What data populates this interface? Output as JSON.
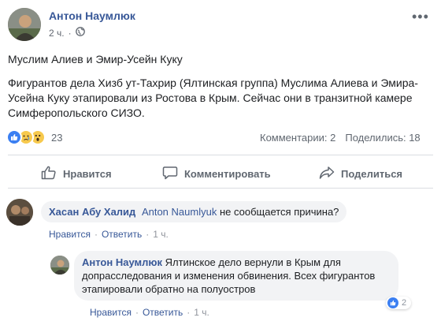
{
  "post": {
    "author": "Антон Наумлюк",
    "time": "2 ч.",
    "more_label": "•••",
    "title": "Муслим Алиев и Эмир-Усейн Куку",
    "body": "Фигурантов дела Хизб ут-Тахрир (Ялтинская группа) Муслима Алиева и Эмира-Усейна Куку этапировали из Ростова в Крым. Сейчас они в транзитной камере Симферопольского СИЗО.",
    "reaction_count": "23",
    "comments_stat": "Комментарии: 2",
    "shares_stat": "Поделились: 18",
    "reaction_icons": [
      "like-icon",
      "sad-icon",
      "wow-icon"
    ],
    "privacy_icon": "globe-icon"
  },
  "actions": {
    "like": "Нравится",
    "comment": "Комментировать",
    "share": "Поделиться"
  },
  "comments": [
    {
      "author": "Хасан Абу Халид",
      "mention": "Anton Naumlyuk",
      "text": " не сообщается причина?",
      "like": "Нравится",
      "reply": "Ответить",
      "time": "1 ч."
    },
    {
      "author": "Антон Наумлюк",
      "text": " Ялтинское дело вернули в Крым для допрасследования и изменения обвинения. Всех фигурантов этапировали обратно на полуостров",
      "like": "Нравится",
      "reply": "Ответить",
      "time": "1 ч.",
      "reaction_count": "2"
    }
  ],
  "colors": {
    "link": "#385898",
    "like_blue": "#3b7ff2",
    "bubble_bg": "#f2f3f5",
    "muted": "#606770"
  }
}
